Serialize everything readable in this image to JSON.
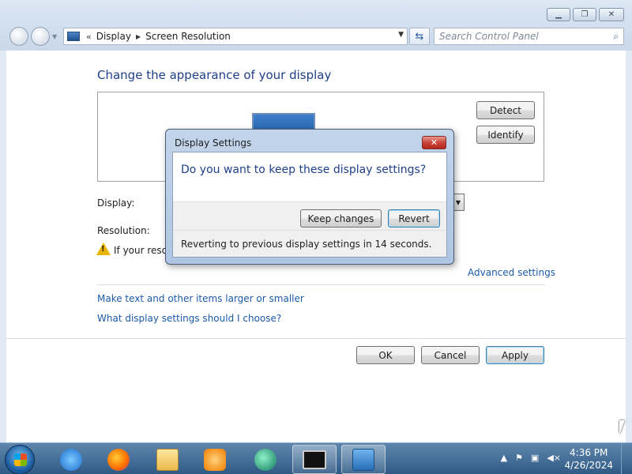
{
  "window": {
    "breadcrumb_sep": "«",
    "breadcrumbs": [
      "Display",
      "Screen Resolution"
    ],
    "search_placeholder": "Search Control Panel"
  },
  "main": {
    "heading": "Change the appearance of your display",
    "detect_label": "Detect",
    "identify_label": "Identify",
    "display_label": "Display:",
    "resolution_label": "Resolution:",
    "warning_text": "If your resolu",
    "advanced_link": "Advanced settings",
    "link_text_size": "Make text and other items larger or smaller",
    "link_which_settings": "What display settings should I choose?",
    "ok_label": "OK",
    "cancel_label": "Cancel",
    "apply_label": "Apply"
  },
  "dialog": {
    "title": "Display Settings",
    "question": "Do you want to keep these display settings?",
    "keep_label": "Keep changes",
    "revert_label": "Revert",
    "footer": "Reverting to previous display settings in 14 seconds."
  },
  "taskbar": {
    "time": "4:36 PM",
    "date": "4/26/2024",
    "items": [
      "internet-explorer-icon",
      "firefox-icon",
      "file-explorer-icon",
      "media-player-icon",
      "app-icon",
      "command-prompt-icon",
      "display-control-panel-icon"
    ]
  }
}
